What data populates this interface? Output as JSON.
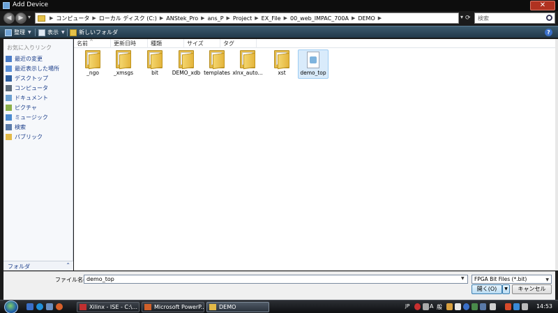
{
  "window": {
    "title": "Add Device",
    "close_glyph": "✕"
  },
  "address": {
    "crumbs": [
      "コンピュータ",
      "ローカル ディスク (C:)",
      "ANStek_Pro",
      "ans_P",
      "Project",
      "EX_File",
      "00_web_IMPAC_700A",
      "DEMO"
    ],
    "search_placeholder": "検索"
  },
  "toolbar": {
    "organize": "整理",
    "views": "表示",
    "new_folder": "新しいフォルダ",
    "help": "?"
  },
  "navpane": {
    "heading": "お気に入りリンク",
    "items": [
      {
        "label": "最近の変更",
        "icon": "recent-changes-icon",
        "color": "#4a7cc8"
      },
      {
        "label": "最近表示した場所",
        "icon": "recent-places-icon",
        "color": "#5a8fd8"
      },
      {
        "label": "デスクトップ",
        "icon": "desktop-icon",
        "color": "#2e5fa0"
      },
      {
        "label": "コンピュータ",
        "icon": "computer-icon",
        "color": "#5a6a7a"
      },
      {
        "label": "ドキュメント",
        "icon": "documents-icon",
        "color": "#6a9fd0"
      },
      {
        "label": "ピクチャ",
        "icon": "pictures-icon",
        "color": "#8ab04a"
      },
      {
        "label": "ミュージック",
        "icon": "music-icon",
        "color": "#4a8ad0"
      },
      {
        "label": "検索",
        "icon": "search-icon",
        "color": "#5a7aa8"
      },
      {
        "label": "パブリック",
        "icon": "public-folder-icon",
        "color": "#e2b948"
      }
    ],
    "folders_label": "フォルダ"
  },
  "columns": [
    "名前",
    "更新日時",
    "種類",
    "サイズ",
    "タグ"
  ],
  "files": [
    {
      "name": "_ngo",
      "type": "folder"
    },
    {
      "name": "_xmsgs",
      "type": "folder"
    },
    {
      "name": "bit",
      "type": "folder"
    },
    {
      "name": "DEMO_xdb",
      "type": "folder"
    },
    {
      "name": "templates",
      "type": "folder"
    },
    {
      "name": "xlnx_auto...",
      "type": "folder"
    },
    {
      "name": "xst",
      "type": "folder"
    },
    {
      "name": "demo_top",
      "type": "file",
      "selected": true
    }
  ],
  "bottom": {
    "filename_label": "ファイル名(N):",
    "filename_value": "demo_top",
    "filter_value": "FPGA Bit Files (*.bit)",
    "open_label": "開く(O)",
    "cancel_label": "キャンセル"
  },
  "taskbar": {
    "tasks": [
      {
        "label": "Xilinx - ISE - C:\\...",
        "icon_color": "#c03030"
      },
      {
        "label": "Microsoft PowerP...",
        "icon_color": "#d0602a"
      },
      {
        "label": "DEMO",
        "icon_color": "#e2b948",
        "active": true
      }
    ],
    "tray_jp": "JP",
    "tray_a": "A",
    "tray_ime": "般",
    "clock": "14:53"
  }
}
